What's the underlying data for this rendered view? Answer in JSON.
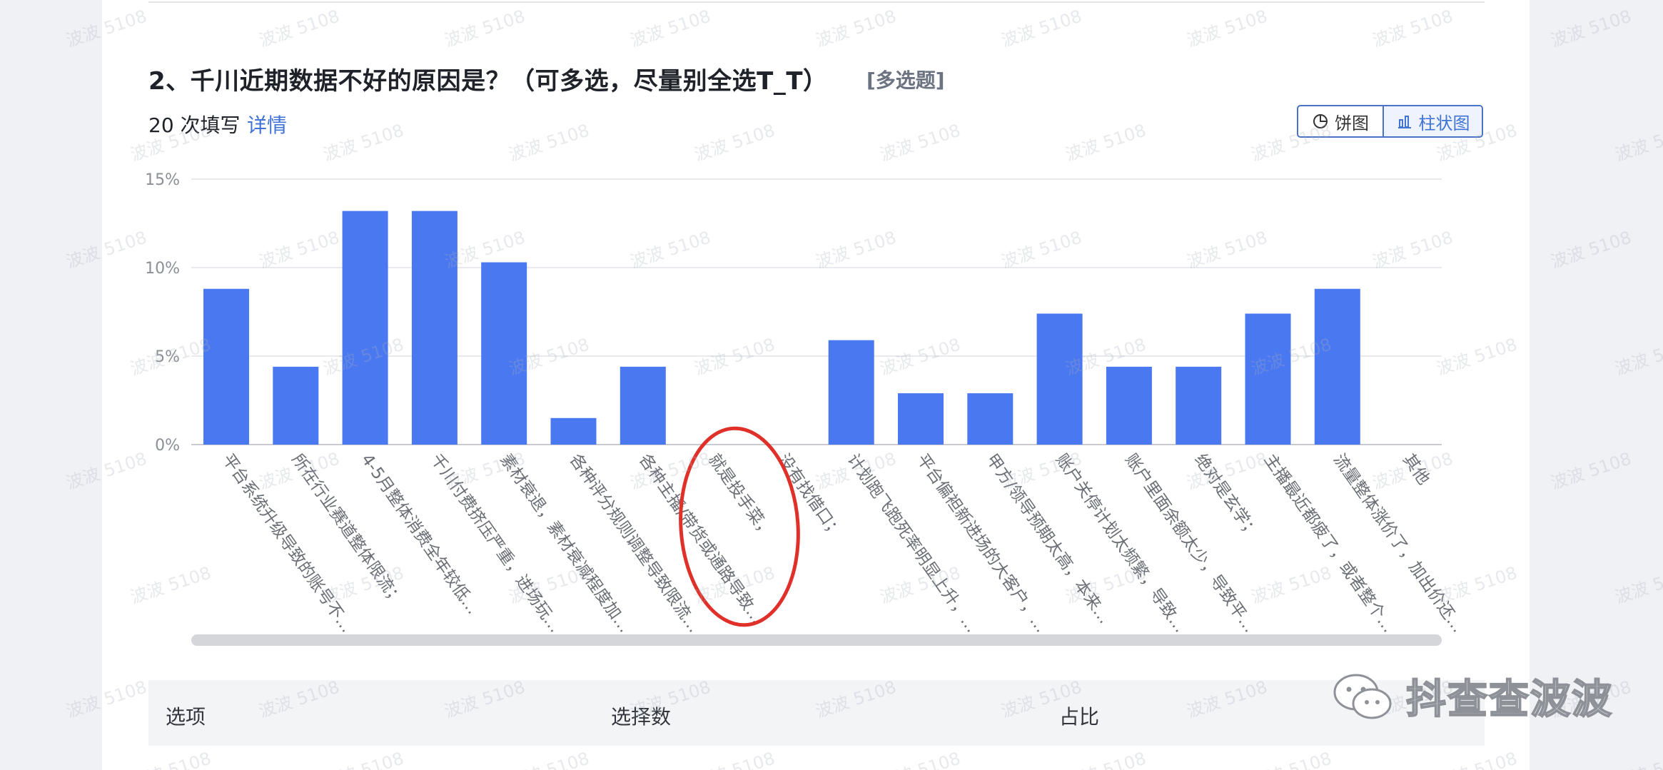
{
  "question": {
    "title": "2、千川近期数据不好的原因是？（可多选，尽量别全选T_T）",
    "tag": "[多选题]",
    "fill_count": "20 次填写",
    "detail_link": "详情"
  },
  "view_toggle": {
    "pie_label": "饼图",
    "bar_label": "柱状图",
    "active": "bar"
  },
  "colors": {
    "bar": "#4a78f0",
    "annotation": "#e0302a",
    "accent_link": "#3f73d6"
  },
  "chart_data": {
    "type": "bar",
    "ylim": [
      0,
      15
    ],
    "y_ticks": [
      "0%",
      "5%",
      "10%",
      "15%"
    ],
    "categories": [
      "平台系统升级导致的账号不…",
      "所在行业赛道整体限流；",
      "4-5月整体消费全年较低…",
      "千川付费挤压严重，进场玩…",
      "素材衰退，素材衰减程度加…",
      "各种评分规则调整导致限流…",
      "各种主播/带货或通路导致…",
      "就是投手菜，",
      "没有找借口；",
      "计划跑飞跑死率明显上升，…",
      "平台偏袒新进场的大客户，…",
      "甲方/领导预期太高，本来…",
      "账户关停计划太频繁，导致…",
      "账户里面余额太少，导致平…",
      "绝对是玄学；",
      "主播最近都疲了，或者整个…",
      "流量整体涨价了，加出价还…",
      "其他"
    ],
    "values": [
      8.8,
      4.4,
      13.2,
      13.2,
      10.3,
      1.5,
      4.4,
      0,
      0,
      5.9,
      2.9,
      2.9,
      7.4,
      4.4,
      4.4,
      7.4,
      8.8,
      0
    ],
    "annotation": "red ellipse circling the empty bar for 就是投手菜"
  },
  "table": {
    "headers": [
      "选项",
      "选择数",
      "占比"
    ]
  },
  "watermark": "波波 5108",
  "brand": {
    "name": "抖查查波波",
    "icon": "wechat-icon"
  }
}
